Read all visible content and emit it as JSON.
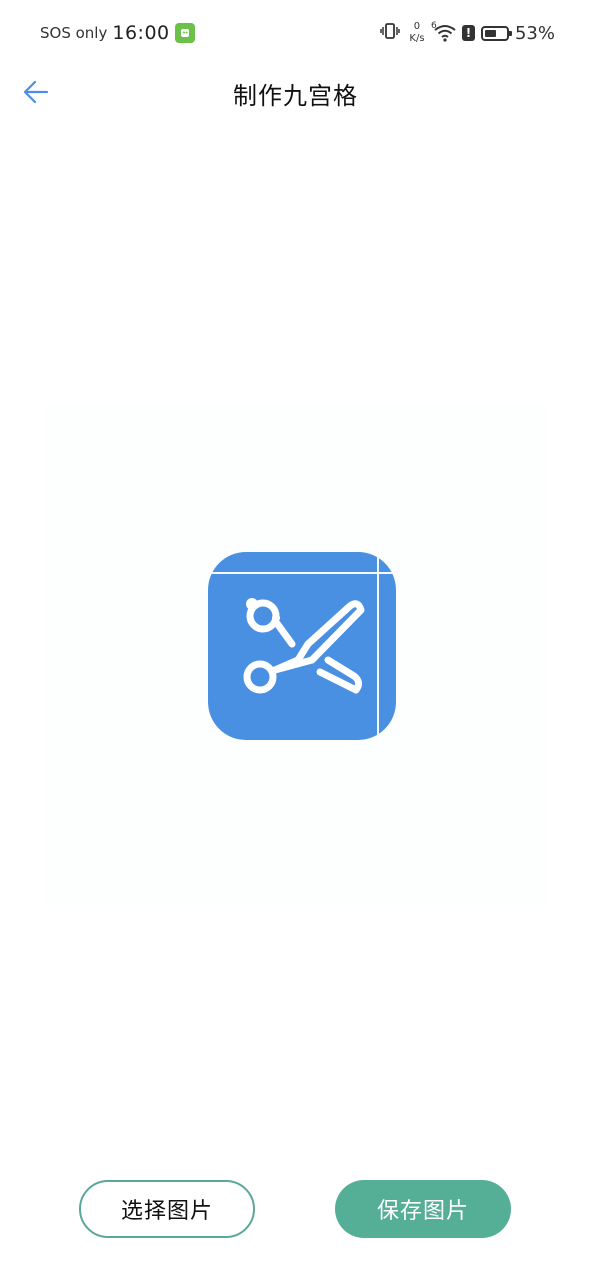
{
  "status_bar": {
    "carrier": "SOS only",
    "time": "16:00",
    "net_speed_value": "0",
    "net_speed_unit": "K/s",
    "wifi_label": "6",
    "battery_percent": "53%",
    "battery_level": 0.53
  },
  "header": {
    "title": "制作九宫格",
    "back_icon": "arrow-left-icon"
  },
  "preview": {
    "image_icon": "scissors-icon",
    "accent_color": "#4a90e2"
  },
  "actions": {
    "select_label": "选择图片",
    "save_label": "保存图片",
    "primary_color": "#55ae96"
  }
}
